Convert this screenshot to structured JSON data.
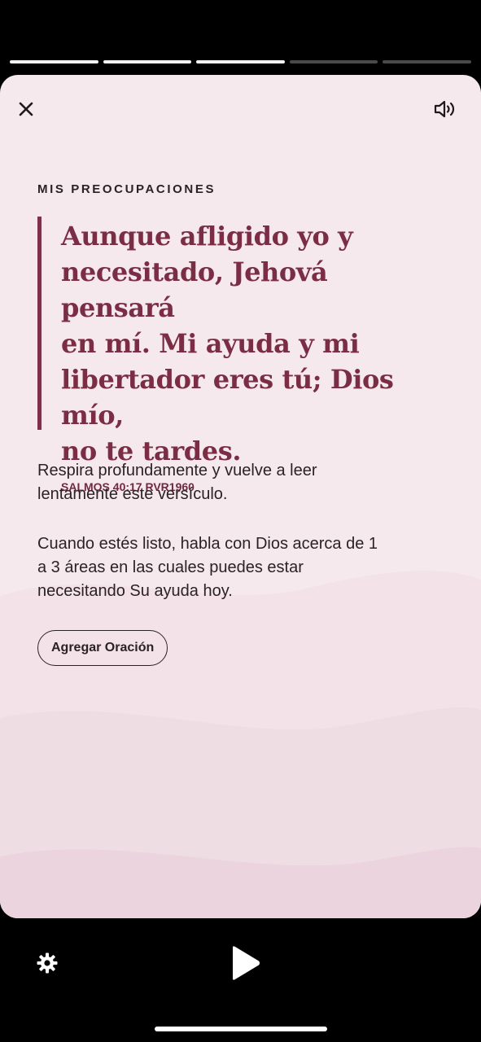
{
  "progress": {
    "total_segments": 5,
    "completed_segments": 3
  },
  "header": {
    "close_icon": "close-icon",
    "sound_icon": "speaker-icon"
  },
  "content": {
    "section_label": "MIS PREOCUPACIONES",
    "verse_lines": [
      "Aunque afligido yo y",
      "necesitado, Jehová pensará",
      "en mí. Mi ayuda y mi",
      "libertador eres tú; Dios mío,",
      "no te tardes."
    ],
    "reference": "SALMOS 40:17 RVR1960",
    "paragraph1_lines": [
      "Respira profundamente y vuelve a leer",
      "lentamente este versículo."
    ],
    "paragraph2_lines": [
      "Cuando estés listo, habla con Dios acerca de 1",
      "a 3 áreas en las cuales puedes estar",
      "necesitando Su ayuda hoy."
    ],
    "add_prayer_label": "Agregar Oración"
  },
  "footer": {
    "settings_icon": "gear-icon",
    "play_icon": "play-icon"
  },
  "colors": {
    "accent": "#7b2d46",
    "card_background": "#f6e9ee",
    "text": "#2a2226"
  }
}
